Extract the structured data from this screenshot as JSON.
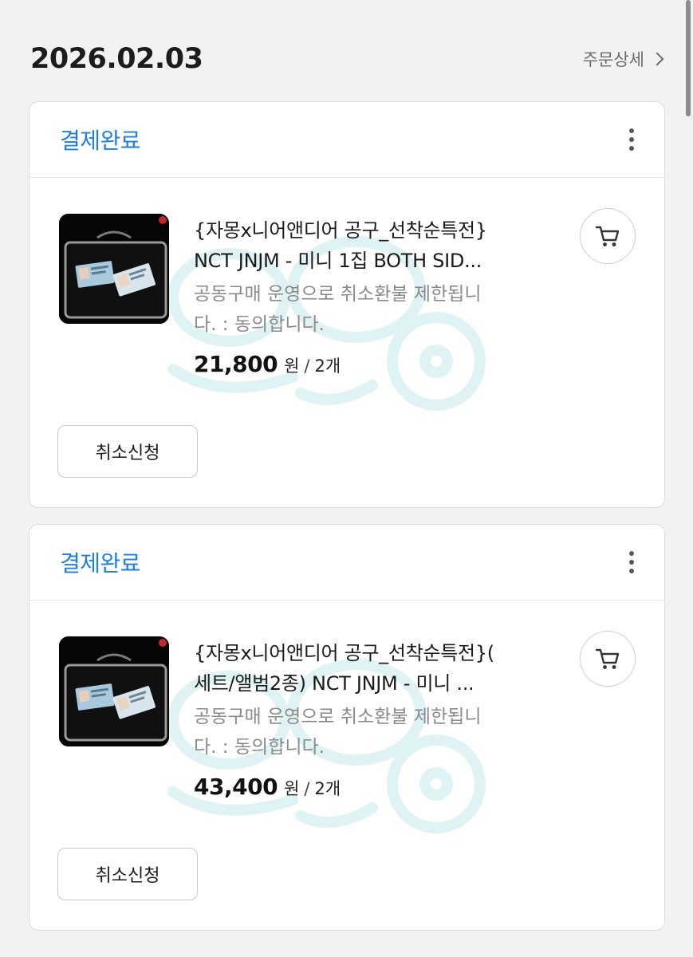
{
  "header": {
    "date": "2026.02.03",
    "order_detail_label": "주문상세"
  },
  "orders": [
    {
      "status": "결제완료",
      "title_line1": "{자몽x니어앤디어 공구_선착순특전}",
      "title_line2": "NCT JNJM - 미니 1집 BOTH SID...",
      "option_line1": "공동구매 운영으로 취소환불 제한됩니",
      "option_line2": "다. : 동의합니다.",
      "price": "21,800",
      "currency": "원",
      "separator": "/",
      "quantity": "2개",
      "cancel_label": "취소신청"
    },
    {
      "status": "결제완료",
      "title_line1": "{자몽x니어앤디어 공구_선착순특전}(",
      "title_line2": "세트/앨범2종) NCT JNJM - 미니 ...",
      "option_line1": "공동구매 운영으로 취소환불 제한됩니",
      "option_line2": "다. : 동의합니다.",
      "price": "43,400",
      "currency": "원",
      "separator": "/",
      "quantity": "2개",
      "cancel_label": "취소신청"
    }
  ],
  "colors": {
    "status_blue": "#1f7fe0",
    "background": "#f2f2f2",
    "card": "#ffffff",
    "watermark": "#dff3f5"
  },
  "icons": {
    "more": "more-vertical-icon",
    "cart": "cart-icon",
    "chevron": "chevron-right-icon"
  }
}
